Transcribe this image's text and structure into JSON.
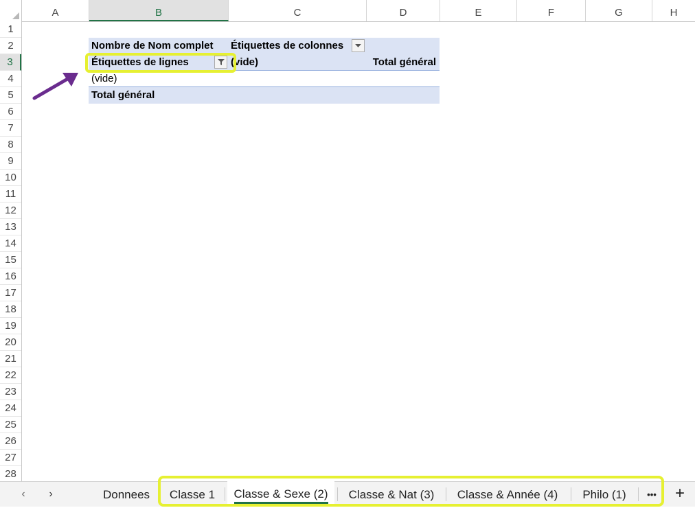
{
  "columns": [
    "A",
    "B",
    "C",
    "D",
    "E",
    "F",
    "G",
    "H"
  ],
  "rows": [
    "1",
    "2",
    "3",
    "4",
    "5",
    "6",
    "7",
    "8",
    "9",
    "10",
    "11",
    "12",
    "13",
    "14",
    "15",
    "16",
    "17",
    "18",
    "19",
    "20",
    "21",
    "22",
    "23",
    "24",
    "25",
    "26",
    "27",
    "28"
  ],
  "pivot": {
    "value_field": "Nombre de Nom complet",
    "column_labels": "Étiquettes de colonnes",
    "row_labels": "Étiquettes de lignes",
    "col_item": "(vide)",
    "total_col": "Total général",
    "row_item": "(vide)",
    "total_row": "Total général"
  },
  "tabs": {
    "sheets": [
      "Donnees",
      "Classe 1",
      "Classe & Sexe (2)",
      "Classe & Nat (3)",
      "Classe & Année (4)",
      "Philo (1)"
    ],
    "active": "Classe & Sexe (2)",
    "more_label": "•••",
    "add_label": "+",
    "prev_label": "‹",
    "next_label": "›"
  },
  "colors": {
    "highlight": "#e6f032",
    "arrow": "#6a2c8e",
    "pivot_bg": "#dbe3f4",
    "accent": "#217346"
  }
}
